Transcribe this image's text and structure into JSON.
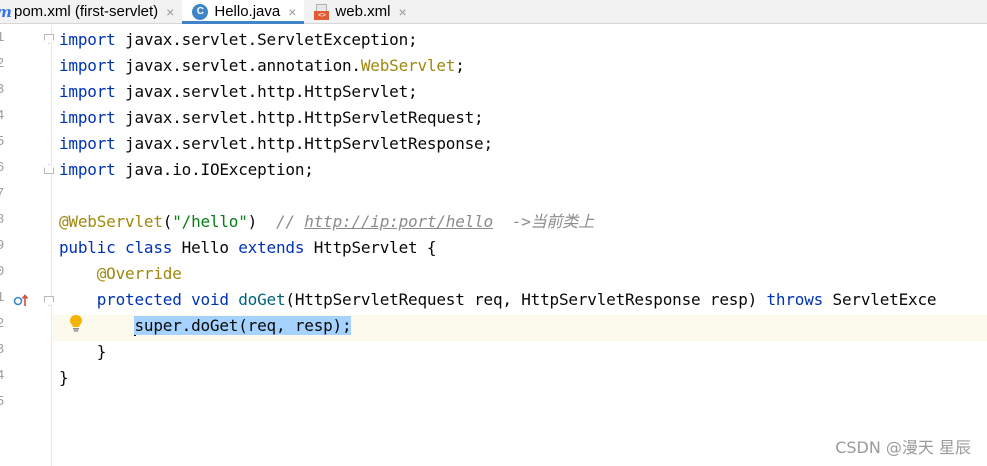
{
  "tabs": [
    {
      "icon": "m",
      "label": "pom.xml (first-servlet)",
      "close": "×"
    },
    {
      "icon": "C",
      "label": "Hello.java",
      "close": "×"
    },
    {
      "icon": "<>",
      "label": "web.xml",
      "close": "×"
    }
  ],
  "gutter": {
    "line_numbers": [
      "1",
      "2",
      "3",
      "4",
      "5",
      "6",
      "7",
      "8",
      "9",
      "0",
      "1",
      "2",
      "3",
      "4",
      "5"
    ]
  },
  "code": {
    "l1": {
      "kw": "import",
      "rest": " javax.servlet.ServletException;"
    },
    "l2": {
      "kw": "import",
      "mid": " javax.servlet.annotation.",
      "ann": "WebServlet",
      "end": ";"
    },
    "l3": {
      "kw": "import",
      "rest": " javax.servlet.http.HttpServlet;"
    },
    "l4": {
      "kw": "import",
      "rest": " javax.servlet.http.HttpServletRequest;"
    },
    "l5": {
      "kw": "import",
      "rest": " javax.servlet.http.HttpServletResponse;"
    },
    "l6": {
      "kw": "import",
      "rest": " java.io.IOException;"
    },
    "l8": {
      "ann": "@WebServlet",
      "open": "(",
      "str": "\"/hello\"",
      "close": ")",
      "cmt_pre": "  // ",
      "url": "http://ip:port/hello",
      "cmt_post": "  ->当前类上"
    },
    "l9": {
      "kw1": "public",
      "kw2": "class",
      "name": " Hello ",
      "kw3": "extends",
      "rest": " HttpServlet {"
    },
    "l10": {
      "ann": "@Override"
    },
    "l11": {
      "kw1": "protected",
      "kw2": "void",
      "mth": "doGet",
      "params": "(HttpServletRequest req, HttpServletResponse resp) ",
      "kw3": "throws",
      "rest": " ServletExce"
    },
    "l12": {
      "selected": "super.doGet(req, resp);"
    },
    "l13": {
      "text": "    }"
    },
    "l14": {
      "text": "}"
    }
  },
  "watermark": "CSDN @漫天 星辰",
  "colors": {
    "keyword": "#0033b3",
    "annotation": "#9e880d",
    "string": "#067d17",
    "comment": "#8c8c8c",
    "method": "#00627a",
    "selection": "#a6d2ff",
    "active_tab_underline": "#4083c9"
  },
  "icons": [
    "maven-icon",
    "java-class-icon",
    "xml-file-icon",
    "close-icon",
    "fold-icon",
    "override-gutter-icon",
    "lightbulb-icon"
  ]
}
